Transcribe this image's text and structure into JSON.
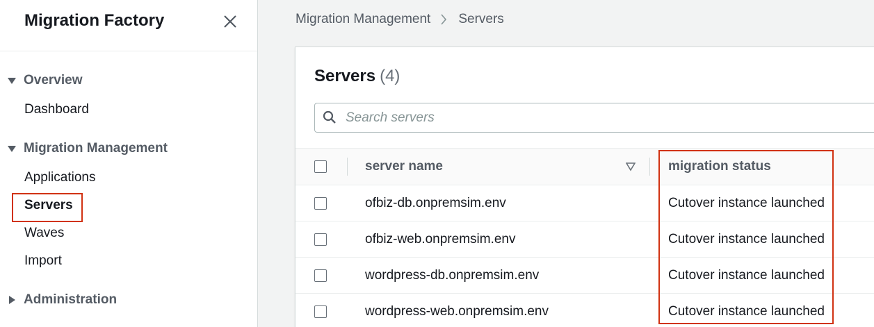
{
  "sidebar": {
    "title": "Migration Factory",
    "sections": [
      {
        "label": "Overview",
        "expanded": true,
        "items": [
          {
            "label": "Dashboard"
          }
        ]
      },
      {
        "label": "Migration Management",
        "expanded": true,
        "items": [
          {
            "label": "Applications"
          },
          {
            "label": "Servers",
            "active": true
          },
          {
            "label": "Waves"
          },
          {
            "label": "Import"
          }
        ]
      },
      {
        "label": "Administration",
        "expanded": false,
        "items": []
      }
    ]
  },
  "breadcrumb": {
    "parent": "Migration Management",
    "current": "Servers"
  },
  "panel": {
    "title": "Servers",
    "count": "(4)",
    "search_placeholder": "Search servers"
  },
  "table": {
    "columns": [
      "server name",
      "migration status"
    ],
    "rows": [
      {
        "server_name": "ofbiz-db.onpremsim.env",
        "status": "Cutover instance launched"
      },
      {
        "server_name": "ofbiz-web.onpremsim.env",
        "status": "Cutover instance launched"
      },
      {
        "server_name": "wordpress-db.onpremsim.env",
        "status": "Cutover instance launched"
      },
      {
        "server_name": "wordpress-web.onpremsim.env",
        "status": "Cutover instance launched"
      }
    ]
  },
  "colors": {
    "highlight": "#d13212",
    "text": "#16191f",
    "muted": "#545b64"
  },
  "icons": [
    "close-icon",
    "caret-down-icon",
    "caret-right-icon",
    "chevron-right-icon",
    "search-icon",
    "sort-down-icon"
  ]
}
